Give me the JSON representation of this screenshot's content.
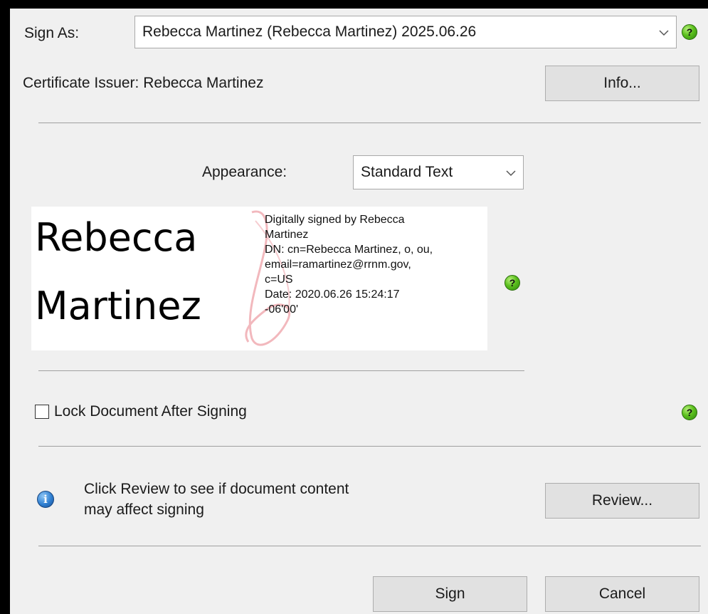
{
  "sign_as": {
    "label": "Sign As:",
    "selected": "Rebecca Martinez (Rebecca Martinez) 2025.06.26"
  },
  "certificate": {
    "issuer_text": "Certificate Issuer: Rebecca Martinez",
    "info_button": "Info..."
  },
  "appearance": {
    "label": "Appearance:",
    "selected": "Standard Text"
  },
  "signature_preview": {
    "name_line1": "Rebecca",
    "name_line2": "Martinez",
    "details": [
      "Digitally signed by Rebecca",
      "Martinez",
      "DN: cn=Rebecca Martinez, o, ou,",
      "email=ramartinez@rrnm.gov,",
      "c=US",
      "Date: 2020.06.26 15:24:17",
      "-06'00'"
    ]
  },
  "lock": {
    "label": "Lock Document After Signing",
    "checked": false
  },
  "review": {
    "message_line1": "Click Review to see if document content",
    "message_line2": "may affect signing",
    "button": "Review..."
  },
  "actions": {
    "sign_button": "Sign",
    "cancel_button": "Cancel"
  },
  "icons": {
    "help": "question-help-icon",
    "info": "info-icon",
    "dropdown": "chevron-down-icon",
    "watermark": "adobe-acrobat-watermark"
  },
  "colors": {
    "help_green": "#5cc01e",
    "info_blue": "#2f7fd1",
    "watermark_pink": "#f2b8bd"
  }
}
